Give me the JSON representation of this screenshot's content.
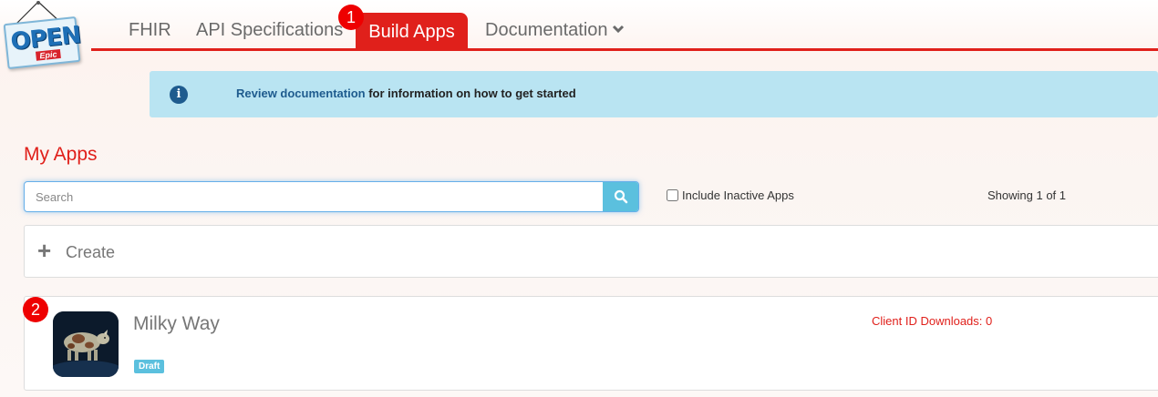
{
  "logo": {
    "main": "OPEN",
    "sub": "Epic"
  },
  "nav": {
    "items": [
      {
        "label": "FHIR"
      },
      {
        "label": "API Specifications"
      },
      {
        "label": "Build Apps"
      },
      {
        "label": "Documentation"
      }
    ],
    "active_badge": "1"
  },
  "info": {
    "link": "Review documentation",
    "text": " for information on how to get started"
  },
  "page": {
    "title": "My Apps",
    "search_placeholder": "Search",
    "include_inactive": "Include Inactive Apps",
    "showing": "Showing 1 of 1"
  },
  "create": {
    "label": "Create"
  },
  "apps": [
    {
      "badge": "2",
      "name": "Milky Way",
      "status": "Draft",
      "downloads": "Client ID Downloads: 0"
    }
  ],
  "colors": {
    "accent": "#e0201b",
    "info_bg": "#b9e4f2",
    "button": "#5bc0de"
  }
}
